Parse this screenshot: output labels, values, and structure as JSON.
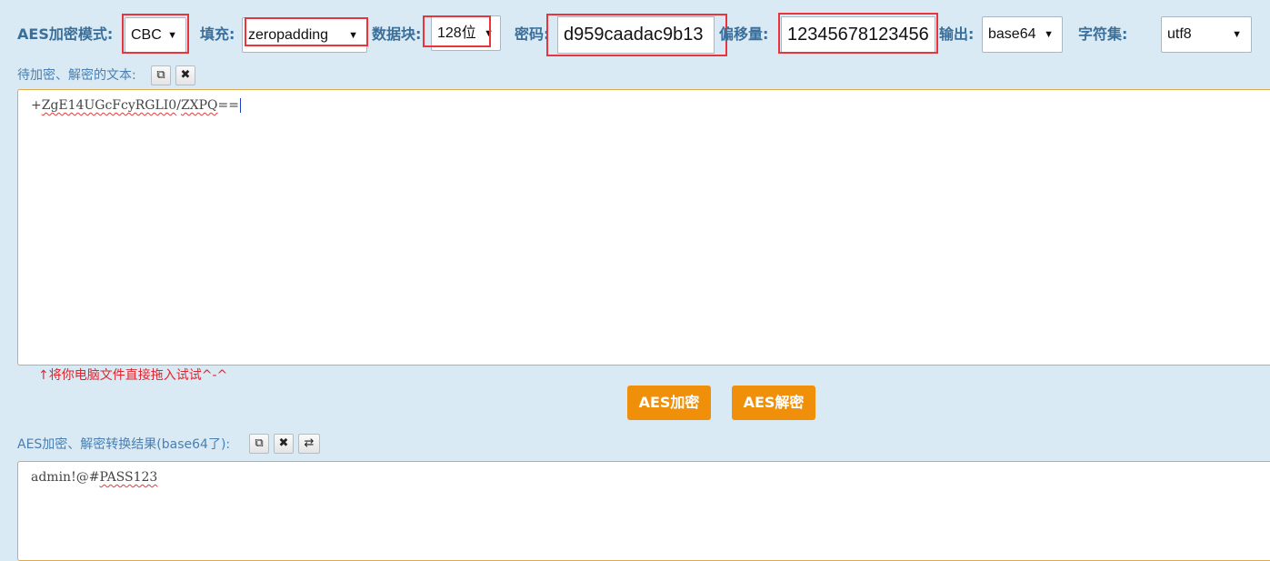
{
  "toolbar": {
    "mode_label": "AES加密模式:",
    "mode_value": "CBC",
    "padding_label": "填充:",
    "padding_value": "zeropadding",
    "block_label": "数据块:",
    "block_value": "128位",
    "key_label": "密码:",
    "key_value": "d959caadac9b13",
    "iv_label": "偏移量:",
    "iv_value": "12345678123456",
    "output_label": "输出:",
    "output_value": "base64",
    "charset_label": "字符集:",
    "charset_value": "utf8"
  },
  "input": {
    "label": "待加密、解密的文本:",
    "text_prefix": "+",
    "text_a": "ZgE14UGcFcyRGLI0",
    "text_sep": "/",
    "text_b": "ZXPQ",
    "text_suffix": "==",
    "hint": "↑将你电脑文件直接拖入试试^-^"
  },
  "actions": {
    "encrypt": "AES加密",
    "decrypt": "AES解密"
  },
  "output": {
    "label": "AES加密、解密转换结果(base64了):",
    "text_a": "admin!@#",
    "text_b": "PASS123"
  },
  "icons": {
    "copy": "copy-icon",
    "clear": "close-icon",
    "swap": "swap-icon"
  },
  "colors": {
    "label": "#3a6f9c",
    "accent_button": "#ef8f0a",
    "highlight_box": "#e8343a",
    "hint": "#e0262c",
    "background": "#d9eaf4"
  }
}
